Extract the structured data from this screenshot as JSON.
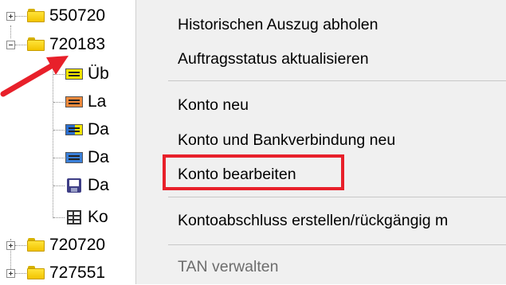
{
  "tree": {
    "nodes": [
      {
        "label": "550720",
        "type": "folder",
        "expanded": false
      },
      {
        "label": "720183",
        "type": "folder",
        "expanded": true
      },
      {
        "label": "Üb",
        "type": "account-yellow-icon"
      },
      {
        "label": "La",
        "type": "account-orange-icon"
      },
      {
        "label": "Da",
        "type": "account-blueyellow-icon"
      },
      {
        "label": "Da",
        "type": "account-blue-icon"
      },
      {
        "label": "Da",
        "type": "floppy-disk-icon"
      },
      {
        "label": "Ko",
        "type": "table-icon"
      },
      {
        "label": "720720",
        "type": "folder",
        "expanded": false
      },
      {
        "label": "727551",
        "type": "folder",
        "expanded": false
      }
    ]
  },
  "context_menu": {
    "items": [
      {
        "label": "Historischen Auszug abholen",
        "enabled": true
      },
      {
        "label": "Auftragsstatus aktualisieren",
        "enabled": true
      },
      {
        "label": "Konto neu",
        "enabled": true
      },
      {
        "label": "Konto und Bankverbindung neu",
        "enabled": true
      },
      {
        "label": "Konto bearbeiten",
        "enabled": true,
        "highlighted": true
      },
      {
        "label": "Kontoabschluss erstellen/rückgängig m",
        "enabled": true
      },
      {
        "label": "TAN verwalten",
        "enabled": false
      }
    ]
  },
  "annotation": {
    "arrow_color": "#e8202a",
    "highlight_color": "#e8202a"
  }
}
